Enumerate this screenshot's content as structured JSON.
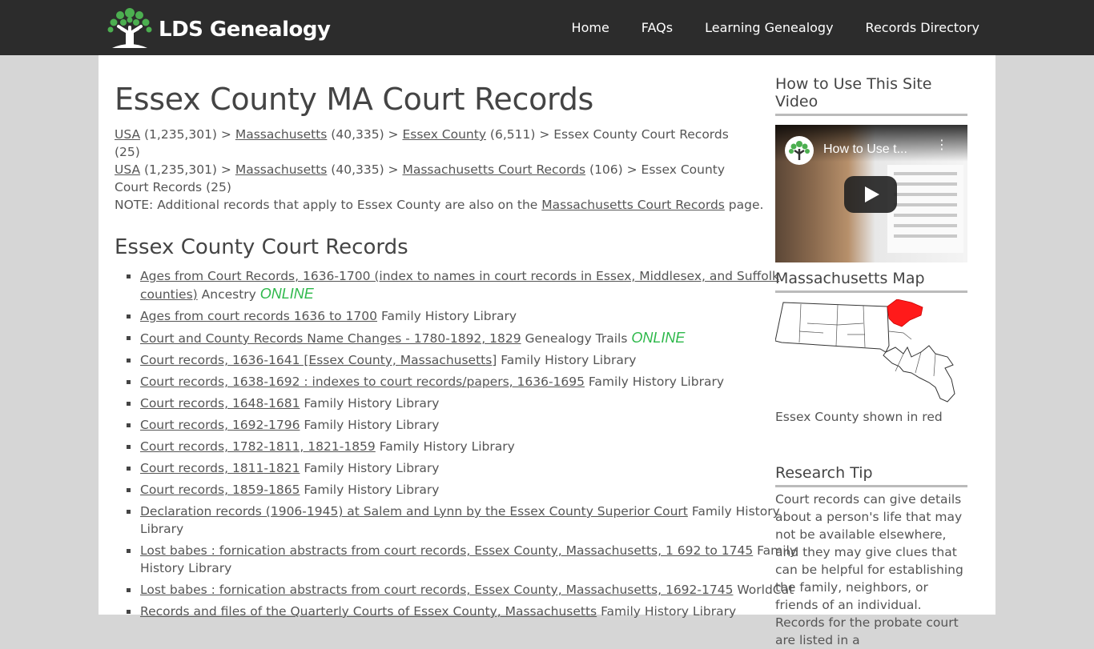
{
  "header": {
    "logo_text": "LDS Genealogy",
    "nav": [
      "Home",
      "FAQs",
      "Learning Genealogy",
      "Records Directory"
    ]
  },
  "main": {
    "title": "Essex County MA Court Records",
    "breadcrumbs": [
      {
        "usa": "USA",
        "usa_count": " (1,235,301) > ",
        "state": "Massachusetts",
        "state_count": " (40,335) > ",
        "link3": "Essex County",
        "link3_count": " (6,511) > ",
        "tail": "Essex County Court Records (25)"
      },
      {
        "usa": "USA",
        "usa_count": " (1,235,301) > ",
        "state": "Massachusetts",
        "state_count": " (40,335) > ",
        "link3": "Massachusetts Court Records",
        "link3_count": " (106) > ",
        "tail": "Essex County Court Records (25)"
      }
    ],
    "note_prefix": "NOTE: Additional records that apply to Essex County are also on the ",
    "note_link": "Massachusetts Court Records",
    "note_suffix": " page.",
    "section_title": "Essex County Court Records",
    "records": [
      {
        "link": "Ages from Court Records, 1636-1700 (index to names in court records in Essex, Middlesex, and Suffolk counties)",
        "source": "Ancestry",
        "online": "ONLINE"
      },
      {
        "link": "Ages from court records 1636 to 1700",
        "source": "Family History Library",
        "online": ""
      },
      {
        "link": "Court and County Records Name Changes - 1780-1892, 1829",
        "source": "Genealogy Trails",
        "online": "ONLINE"
      },
      {
        "link": "Court records, 1636-1641 [Essex County, Massachusetts]",
        "source": "Family History Library",
        "online": ""
      },
      {
        "link": "Court records, 1638-1692 : indexes to court records/papers, 1636-1695",
        "source": "Family History Library",
        "online": ""
      },
      {
        "link": "Court records, 1648-1681",
        "source": "Family History Library",
        "online": ""
      },
      {
        "link": "Court records, 1692-1796",
        "source": "Family History Library",
        "online": ""
      },
      {
        "link": "Court records, 1782-1811, 1821-1859",
        "source": "Family History Library",
        "online": ""
      },
      {
        "link": "Court records, 1811-1821",
        "source": "Family History Library",
        "online": ""
      },
      {
        "link": "Court records, 1859-1865",
        "source": "Family History Library",
        "online": ""
      },
      {
        "link": "Declaration records (1906-1945) at Salem and Lynn by the Essex County Superior Court",
        "source": "Family History Library",
        "online": ""
      },
      {
        "link": "Lost babes : fornication abstracts from court records, Essex County, Massachusetts, 1 692 to 1745",
        "source": "Family History Library",
        "online": ""
      },
      {
        "link": "Lost babes : fornication abstracts from court records, Essex County, Massachusetts, 1692-1745",
        "source": "WorldCat",
        "online": ""
      },
      {
        "link": "Records and files of the Quarterly Courts of Essex County, Massachusetts",
        "source": "Family History Library",
        "online": ""
      }
    ]
  },
  "sidebar": {
    "video_heading": "How to Use This Site Video",
    "video_title": "How to Use t...",
    "map_heading": "Massachusetts Map",
    "map_caption": "Essex County shown in red",
    "tip_heading": "Research Tip",
    "tip_text": "Court records can give details about a person's life that may not be available elsewhere, and they may give clues that can be helpful for establishing the family, neighbors, or friends of an individual.  Records for the probate court are listed in a"
  },
  "colors": {
    "header_bg": "#2c2c2c",
    "page_bg": "#d6d6d6",
    "online_green": "#2db84a",
    "essex_red": "#ff1a1a"
  }
}
